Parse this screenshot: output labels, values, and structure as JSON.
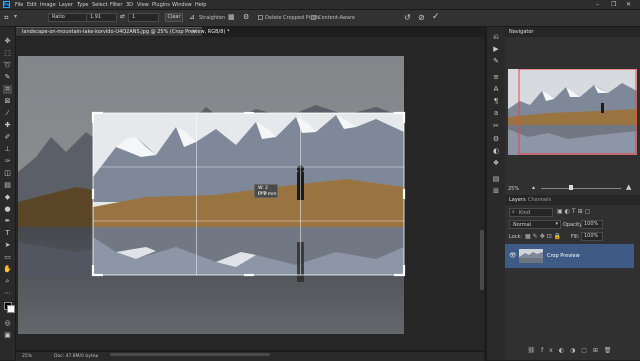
{
  "menubar": {
    "items": [
      "File",
      "Edit",
      "Image",
      "Layer",
      "Type",
      "Select",
      "Filter",
      "3D",
      "View",
      "Plugins",
      "Window",
      "Help"
    ],
    "app_icon": "Ps"
  },
  "options": {
    "ratio_value": "Ratio",
    "width_value": "1.91",
    "height_value": "1",
    "clear_label": "Clear",
    "straighten_label": "Straighten",
    "delete_cropped_label": "Delete Cropped Pixels",
    "content_aware_label": "Content-Aware"
  },
  "document": {
    "tab_title": "landscape-on-mountain-lake-korvido-U4Q2ANS.jpg @ 25% (Crop Preview, RGB/8) *",
    "zoom": "25%",
    "doc_info": "Doc: 47.8M/0 bytes",
    "crop_tooltip_w": "W: 2 mm",
    "crop_tooltip_h": "L: 2 mm"
  },
  "navigator": {
    "title": "Navigator",
    "zoom": "25%"
  },
  "layers": {
    "tab_layers": "Layers",
    "tab_channels": "Channels",
    "search_placeholder": "Kind",
    "blend_mode": "Normal",
    "opacity_label": "Opacity:",
    "opacity_value": "100%",
    "lock_label": "Lock:",
    "fill_label": "Fill:",
    "fill_value": "100%",
    "layer_name": "Crop Preview"
  }
}
